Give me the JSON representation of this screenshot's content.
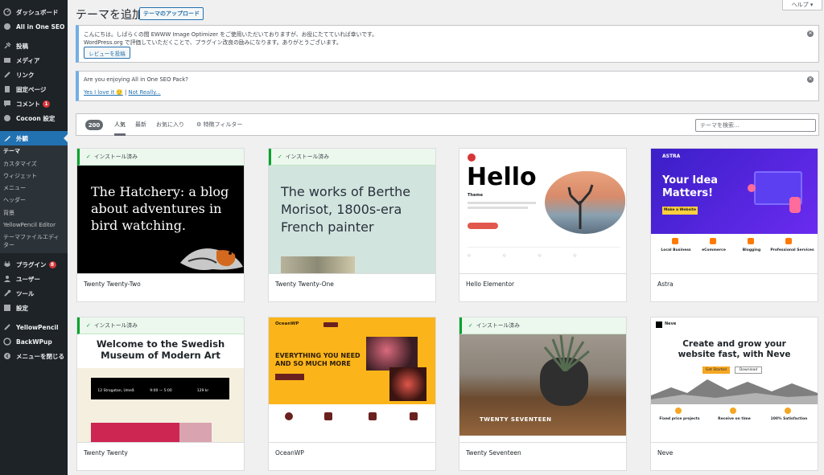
{
  "sidebar": {
    "items": [
      {
        "label": "ダッシュボード",
        "icon": "dashboard-icon"
      },
      {
        "label": "All in One SEO",
        "icon": "seo-icon"
      },
      {
        "label": "投稿",
        "icon": "pin-icon"
      },
      {
        "label": "メディア",
        "icon": "media-icon"
      },
      {
        "label": "リンク",
        "icon": "link-icon"
      },
      {
        "label": "固定ページ",
        "icon": "page-icon"
      },
      {
        "label": "コメント",
        "icon": "comment-icon",
        "badge": "1"
      },
      {
        "label": "Cocoon 設定",
        "icon": "cocoon-icon"
      },
      {
        "label": "外観",
        "icon": "appearance-icon"
      },
      {
        "label": "プラグイン",
        "icon": "plugin-icon",
        "badge": "8"
      },
      {
        "label": "ユーザー",
        "icon": "user-icon"
      },
      {
        "label": "ツール",
        "icon": "tools-icon"
      },
      {
        "label": "設定",
        "icon": "settings-icon"
      },
      {
        "label": "YellowPencil",
        "icon": "pencil-icon"
      },
      {
        "label": "BackWPup",
        "icon": "backup-icon"
      },
      {
        "label": "メニューを閉じる",
        "icon": "collapse-icon"
      }
    ],
    "submenu": [
      "テーマ",
      "カスタマイズ",
      "ウィジェット",
      "メニュー",
      "ヘッダー",
      "背景",
      "YellowPencil Editor",
      "テーマファイルエディ",
      "ター"
    ]
  },
  "header": {
    "title": "テーマを追加",
    "upload_label": "テーマのアップロード",
    "help_label": "ヘルプ ▾"
  },
  "notices": {
    "ewww_line1": "こんにちは。しばらくの間 EWWW Image Optimizer をご使用いただいておりますが、お役にたてていれば幸いです。",
    "ewww_line2": "WordPress.org で評価していただくことで、プラグイン改良の励みになります。ありがとうございます。",
    "ewww_button": "レビューを投稿",
    "aioseo_question": "Are you enjoying All in One SEO Pack?",
    "aioseo_yes": "Yes I love it 🙂",
    "aioseo_sep": " | ",
    "aioseo_no": "Not Really..."
  },
  "filter": {
    "count": "200",
    "tabs": [
      "人気",
      "最新",
      "お気に入り",
      "⚙ 特徴フィルター"
    ],
    "search_placeholder": "テーマを検索..."
  },
  "installed_label": "インストール済み",
  "themes": [
    {
      "name": "Twenty Twenty-Two",
      "installed": true,
      "shot_text": "The Hatchery: a blog about adventures in bird watching."
    },
    {
      "name": "Twenty Twenty-One",
      "installed": true,
      "shot_text": "The works of Berthe Morisot, 1800s-era French painter"
    },
    {
      "name": "Hello Elementor",
      "installed": false,
      "shot_text": "Hello",
      "shot_sub": "Theme"
    },
    {
      "name": "Astra",
      "installed": false,
      "shot_text": "Your Idea Matters!",
      "shot_sub": "ASTRA",
      "features": [
        "Local Business",
        "eCommerce",
        "Blogging",
        "Professional Services"
      ],
      "shot_button": "Make a Website"
    },
    {
      "name": "Twenty Twenty",
      "installed": true,
      "shot_text": "Welcome to the Swedish Museum of Modern Art",
      "details": [
        "12 Strogatan, Umeå",
        "9:00 — 5:00",
        "129 kr"
      ]
    },
    {
      "name": "OceanWP",
      "installed": false,
      "shot_text": "EVERYTHING YOU NEED AND SO MUCH MORE",
      "shot_sub": "OceanWP"
    },
    {
      "name": "Twenty Seventeen",
      "installed": true,
      "shot_text": "TWENTY SEVENTEEN"
    },
    {
      "name": "Neve",
      "installed": false,
      "shot_text": "Create and grow your website fast, with Neve",
      "features": [
        "Fixed price projects",
        "Receive on time",
        "100% Satisfaction"
      ],
      "shot_sub": "Neve",
      "shot_buttons": [
        "Get Started",
        "Download"
      ]
    }
  ],
  "colors": {
    "sidebar_bg": "#1d2327",
    "active": "#2271b1",
    "installed_green": "#00a32a",
    "astra_purple": "#4a2fe0",
    "ocean_yellow": "#fbb51a"
  }
}
